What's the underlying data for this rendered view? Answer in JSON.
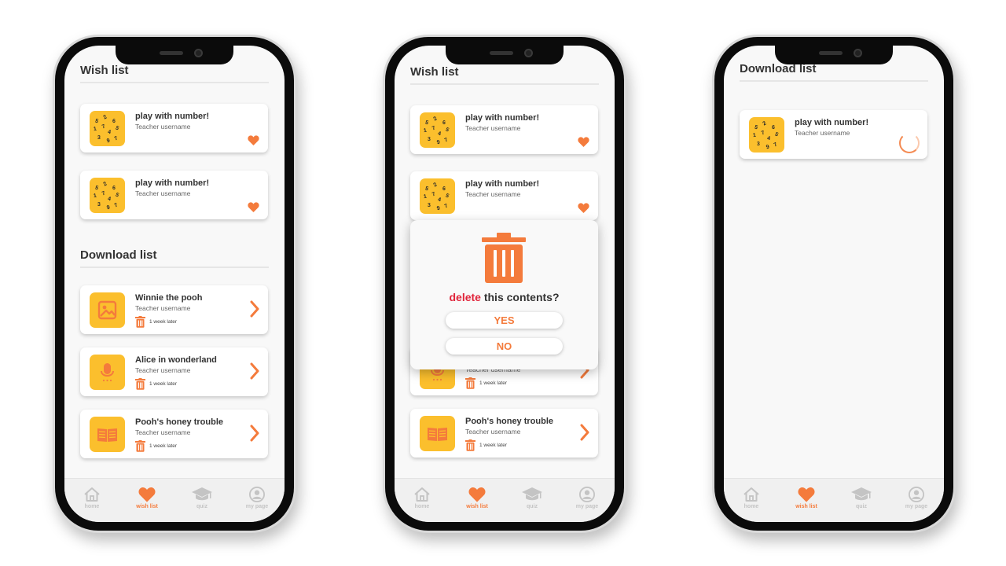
{
  "colors": {
    "accent": "#f47b3c",
    "thumb_bg": "#fbbf2d",
    "danger": "#e0243a",
    "inactive": "#c4c4c4"
  },
  "thumb_digits": [
    "2",
    "5",
    "6",
    "1",
    "7",
    "5",
    "4",
    "3",
    "9",
    "7"
  ],
  "screens": [
    {
      "wish_title": "Wish list",
      "wish_items": [
        {
          "title": "play with number!",
          "sub": "Teacher username",
          "icon": "heart-icon"
        },
        {
          "title": "play with number!",
          "sub": "Teacher username",
          "icon": "heart-icon"
        }
      ],
      "download_title": "Download list",
      "download_items": [
        {
          "title": "Winnie the pooh",
          "sub": "Teacher username",
          "meta": "1 week later",
          "type": "image-icon"
        },
        {
          "title": "Alice in wonderland",
          "sub": "Teacher username",
          "meta": "1 week later",
          "type": "microphone-icon"
        },
        {
          "title": "Pooh's honey trouble",
          "sub": "Teacher username",
          "meta": "1 week later",
          "type": "book-icon"
        }
      ]
    },
    {
      "wish_title": "Wish list",
      "wish_items": [
        {
          "title": "play with number!",
          "sub": "Teacher username"
        },
        {
          "title": "play with number!",
          "sub": "Teacher username"
        }
      ],
      "download_items": [
        {
          "sub": "Teacher username",
          "meta": "1 week later"
        },
        {
          "title": "Pooh's honey trouble",
          "sub": "Teacher username",
          "meta": "1 week later"
        }
      ],
      "dialog": {
        "question_highlight": "delete",
        "question_rest": " this contents?",
        "yes": "YES",
        "no": "NO"
      }
    },
    {
      "download_title": "Download list",
      "download_items": [
        {
          "title": "play with number!",
          "sub": "Teacher username",
          "status": "loading-spinner"
        }
      ]
    }
  ],
  "tabs": [
    {
      "label": "home",
      "icon": "home-icon"
    },
    {
      "label": "wish list",
      "icon": "heart-icon",
      "active": true
    },
    {
      "label": "quiz",
      "icon": "graduation-cap-icon"
    },
    {
      "label": "my page",
      "icon": "user-icon"
    }
  ]
}
